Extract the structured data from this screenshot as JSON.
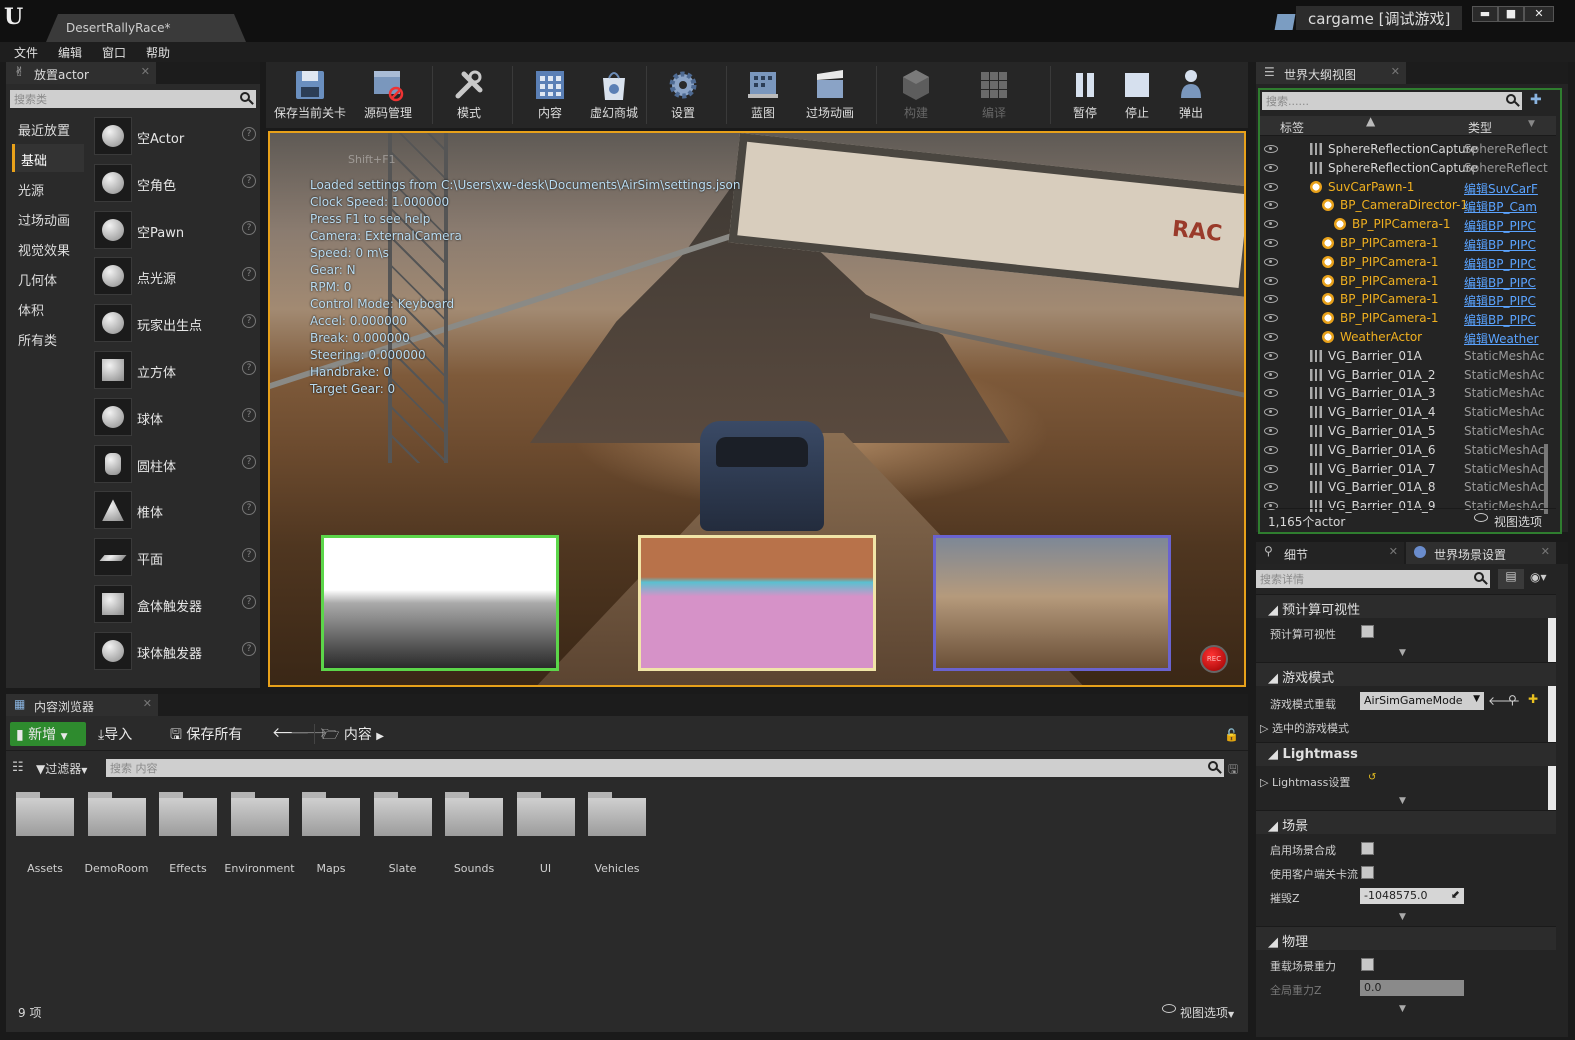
{
  "window": {
    "doc_tab": "DesertRallyRace*",
    "project_title": "cargame [调试游戏]",
    "controls": {
      "minimize": "▬",
      "maximize": "■",
      "close": "✕"
    }
  },
  "menu": [
    "文件",
    "编辑",
    "窗口",
    "帮助"
  ],
  "place_actors": {
    "tab_title": "放置actor",
    "search_placeholder": "搜索类",
    "categories": [
      "最近放置",
      "基础",
      "光源",
      "过场动画",
      "视觉效果",
      "几何体",
      "体积",
      "所有类"
    ],
    "selected_category": "基础",
    "items": [
      "空Actor",
      "空角色",
      "空Pawn",
      "点光源",
      "玩家出生点",
      "立方体",
      "球体",
      "圆柱体",
      "椎体",
      "平面",
      "盒体触发器",
      "球体触发器"
    ]
  },
  "toolbar": {
    "buttons": [
      "保存当前关卡",
      "源码管理",
      "模式",
      "内容",
      "虚幻商城",
      "设置",
      "蓝图",
      "过场动画",
      "构建",
      "编译",
      "暂停",
      "停止",
      "弹出"
    ]
  },
  "viewport": {
    "hint": "Shift+F1",
    "osd_lines": [
      "Loaded settings from C:\\Users\\xw-desk\\Documents\\AirSim\\settings.json",
      "Clock Speed: 1.000000",
      "Press F1 to see help",
      "Camera: ExternalCamera",
      "Speed: 0 m\\s",
      "Gear: N",
      "RPM: 0",
      "Control Mode: Keyboard",
      "Accel: 0.000000",
      "Break: 0.000000",
      "Steering: 0.000000",
      "Handbrake: 0",
      "Target Gear: 0"
    ],
    "billboard_text": "RAC",
    "rec_label": "REC"
  },
  "outliner": {
    "tab_title": "世界大纲视图",
    "search_placeholder": "搜索......",
    "col_label": "标签",
    "col_type": "类型",
    "rows": [
      {
        "name": "SphereReflectionCapture",
        "type": "SphereReflect",
        "indent": 1,
        "link": false,
        "hl": false
      },
      {
        "name": "SphereReflectionCapture",
        "type": "SphereReflect",
        "indent": 1,
        "link": false,
        "hl": false
      },
      {
        "name": "SuvCarPawn-1",
        "type": "编辑SuvCarF",
        "indent": 1,
        "link": true,
        "hl": true
      },
      {
        "name": "BP_CameraDirector-1",
        "type": "编辑BP_Cam",
        "indent": 2,
        "link": true,
        "hl": true
      },
      {
        "name": "BP_PIPCamera-1",
        "type": "编辑BP_PIPC",
        "indent": 3,
        "link": true,
        "hl": true
      },
      {
        "name": "BP_PIPCamera-1",
        "type": "编辑BP_PIPC",
        "indent": 2,
        "link": true,
        "hl": true
      },
      {
        "name": "BP_PIPCamera-1",
        "type": "编辑BP_PIPC",
        "indent": 2,
        "link": true,
        "hl": true
      },
      {
        "name": "BP_PIPCamera-1",
        "type": "编辑BP_PIPC",
        "indent": 2,
        "link": true,
        "hl": true
      },
      {
        "name": "BP_PIPCamera-1",
        "type": "编辑BP_PIPC",
        "indent": 2,
        "link": true,
        "hl": true
      },
      {
        "name": "BP_PIPCamera-1",
        "type": "编辑BP_PIPC",
        "indent": 2,
        "link": true,
        "hl": true
      },
      {
        "name": "WeatherActor",
        "type": "编辑Weather",
        "indent": 2,
        "link": true,
        "hl": true
      },
      {
        "name": "VG_Barrier_01A",
        "type": "StaticMeshAc",
        "indent": 1,
        "link": false,
        "hl": false
      },
      {
        "name": "VG_Barrier_01A_2",
        "type": "StaticMeshAc",
        "indent": 1,
        "link": false,
        "hl": false
      },
      {
        "name": "VG_Barrier_01A_3",
        "type": "StaticMeshAc",
        "indent": 1,
        "link": false,
        "hl": false
      },
      {
        "name": "VG_Barrier_01A_4",
        "type": "StaticMeshAc",
        "indent": 1,
        "link": false,
        "hl": false
      },
      {
        "name": "VG_Barrier_01A_5",
        "type": "StaticMeshAc",
        "indent": 1,
        "link": false,
        "hl": false
      },
      {
        "name": "VG_Barrier_01A_6",
        "type": "StaticMeshAc",
        "indent": 1,
        "link": false,
        "hl": false
      },
      {
        "name": "VG_Barrier_01A_7",
        "type": "StaticMeshAc",
        "indent": 1,
        "link": false,
        "hl": false
      },
      {
        "name": "VG_Barrier_01A_8",
        "type": "StaticMeshAc",
        "indent": 1,
        "link": false,
        "hl": false
      },
      {
        "name": "VG_Barrier_01A_9",
        "type": "StaticMeshAc",
        "indent": 1,
        "link": false,
        "hl": false
      }
    ],
    "actor_count": "1,165个actor",
    "view_options": "视图选项"
  },
  "details": {
    "tab_details": "细节",
    "tab_world": "世界场景设置",
    "search_placeholder": "搜索详情",
    "sections": {
      "precomputed_visibility": "预计算可视性",
      "game_mode": "游戏模式",
      "lightmass": "Lightmass",
      "world": "场景",
      "physics": "物理"
    },
    "props": {
      "precomputed_visibility": "预计算可视性",
      "game_mode_override": "游戏模式重载",
      "game_mode_value": "AirSimGameMode",
      "selected_game_mode": "选中的游戏模式",
      "lightmass_settings": "Lightmass设置",
      "enable_world_composition": "启用场景合成",
      "use_client_side_streaming": "使用客户端关卡流",
      "kill_z": "摧毁Z",
      "kill_z_value": "-1048575.0",
      "override_world_gravity": "重载场景重力",
      "global_gravity_z": "全局重力Z",
      "global_gravity_z_value": "0.0"
    }
  },
  "content_browser": {
    "tab_title": "内容浏览器",
    "new_button": "新增",
    "import_button": "导入",
    "save_all_button": "保存所有",
    "path": "内容",
    "filters": "过滤器",
    "search_placeholder": "搜索 内容",
    "folders": [
      "Assets",
      "DemoRoom",
      "Effects",
      "Environment",
      "Maps",
      "Slate",
      "Sounds",
      "UI",
      "Vehicles"
    ],
    "item_count": "9 项",
    "view_options": "视图选项"
  },
  "colors": {
    "accent": "#e8a11a",
    "selection_green": "#4caf50",
    "link_blue": "#5aa3ff"
  }
}
